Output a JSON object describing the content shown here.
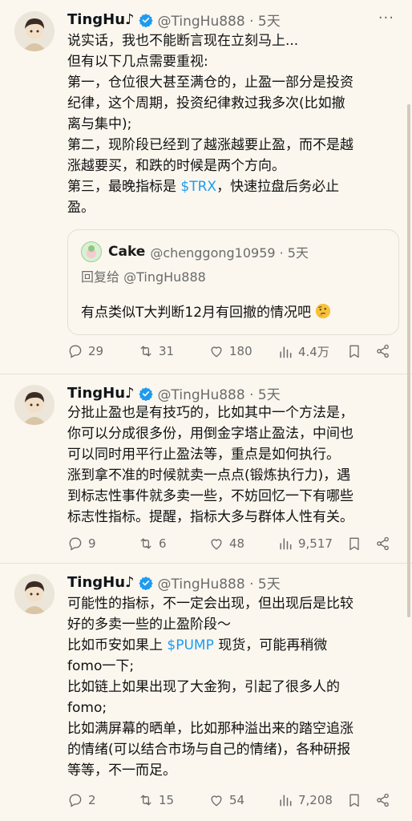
{
  "tweets": [
    {
      "name": "TingHu♪",
      "handle": "@TingHu888 · 5天",
      "lines": [
        "说实话，我也不能断言现在立刻马上...",
        "但有以下几点需要重视:",
        "第一，仓位很大甚至满仓的，止盈一部分是投资",
        "纪律，这个周期，投资纪律救过我多次(比如撤",
        "离与集中);",
        "第二，现阶段已经到了越涨越要止盈，而不是越",
        "涨越要买，和跌的时候是两个方向。",
        {
          "before": "第三，最晚指标是 ",
          "tag": "$TRX",
          "after": "，快速拉盘后务必止"
        },
        "盈。"
      ],
      "quote": {
        "name": "Cake",
        "handle": "@chenggong10959 · 5天",
        "reply": "回复给 @TingHu888",
        "text": "有点类似T大判断12月有回撤的情况吧"
      },
      "stats": {
        "replies": "29",
        "retweets": "31",
        "likes": "180",
        "views": "4.4万"
      }
    },
    {
      "name": "TingHu♪",
      "handle": "@TingHu888 · 5天",
      "lines": [
        "分批止盈也是有技巧的，比如其中一个方法是，",
        "你可以分成很多份，用倒金字塔止盈法，中间也",
        "可以同时用平行止盈法等，重点是如何执行。",
        "涨到拿不准的时候就卖一点点(锻炼执行力)，遇",
        "到标志性事件就多卖一些，不妨回忆一下有哪些",
        "标志性指标。提醒，指标大多与群体人性有关。"
      ],
      "stats": {
        "replies": "9",
        "retweets": "6",
        "likes": "48",
        "views": "9,517"
      }
    },
    {
      "name": "TingHu♪",
      "handle": "@TingHu888 · 5天",
      "lines": [
        "可能性的指标，不一定会出现，但出现后是比较",
        "好的多卖一些的止盈阶段～",
        {
          "before": "比如币安如果上 ",
          "tag": "$PUMP",
          "after": " 现货，可能再稍微"
        },
        "fomo一下;",
        "比如链上如果出现了大金狗，引起了很多人的",
        "fomo;",
        "比如满屏幕的晒单，比如那种溢出来的踏空追涨",
        "的情绪(可以结合市场与自己的情绪)，各种研报",
        "等等，不一而足。"
      ],
      "stats": {
        "replies": "2",
        "retweets": "15",
        "likes": "54",
        "views": "7,208"
      }
    }
  ],
  "colors": {
    "background": "#fbf7ef",
    "accent": "#1d9bf0",
    "muted": "#6b6b6b"
  },
  "icons": [
    "verified-badge-icon",
    "more-icon",
    "reply-icon",
    "retweet-icon",
    "like-icon",
    "views-icon",
    "bookmark-icon",
    "share-icon"
  ]
}
